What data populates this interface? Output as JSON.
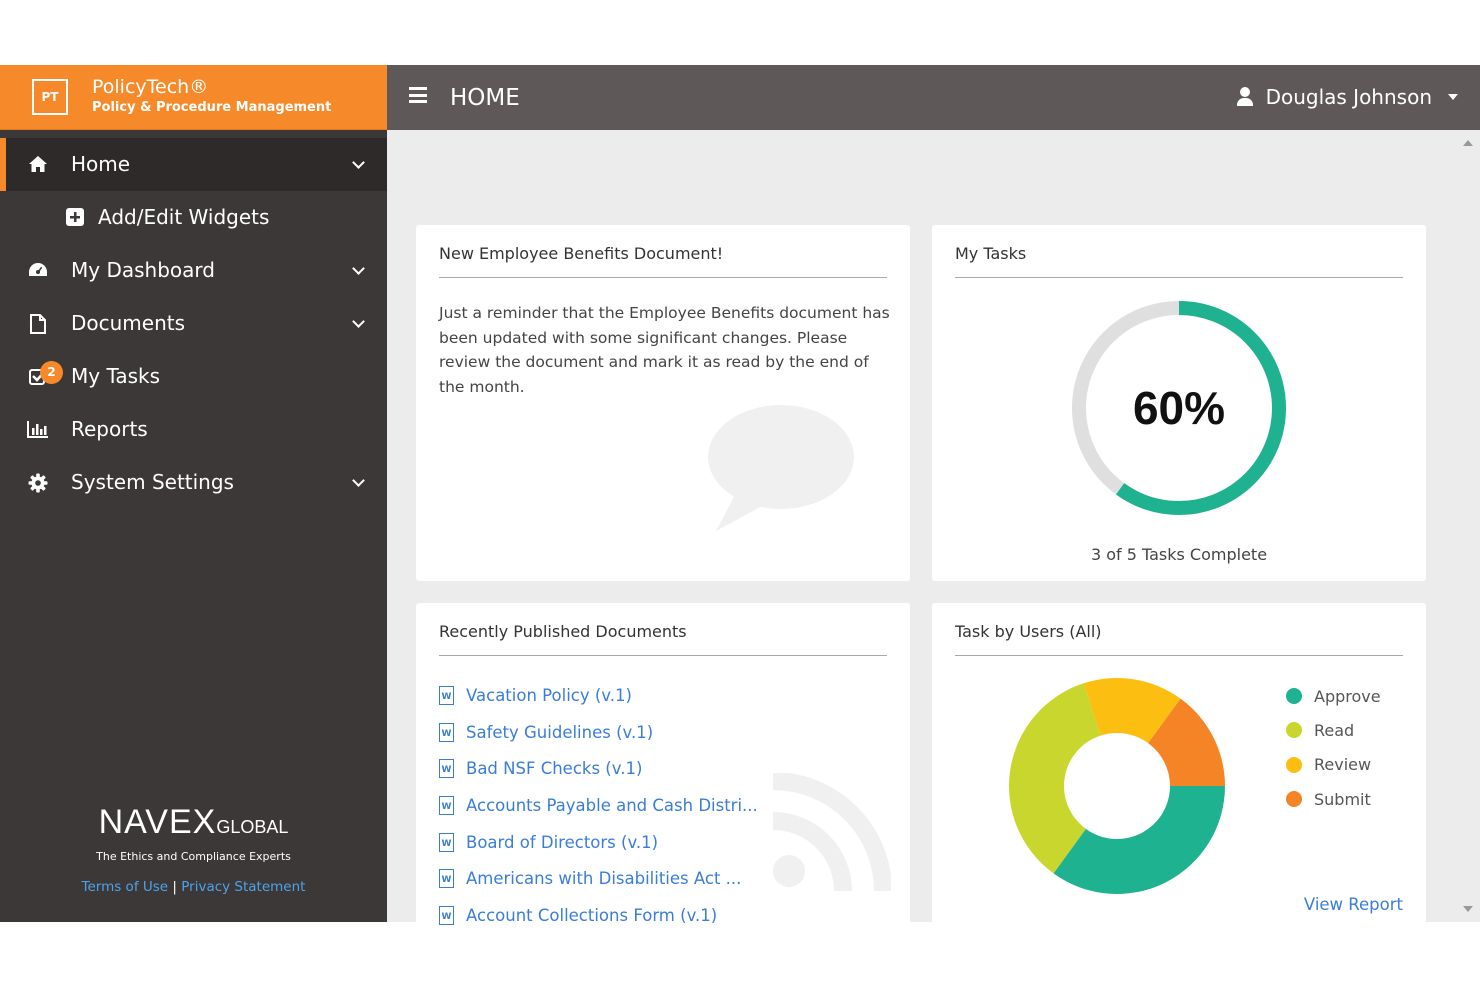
{
  "brand": {
    "logo_text": "PT",
    "title": "PolicyTech®",
    "subtitle": "Policy & Procedure Management"
  },
  "header": {
    "title": "HOME",
    "user_name": "Douglas Johnson"
  },
  "sidebar": {
    "items": [
      {
        "label": "Home",
        "icon": "home-icon"
      },
      {
        "label": "Add/Edit Widgets",
        "icon": "plus-square-icon"
      },
      {
        "label": "My Dashboard",
        "icon": "dashboard-icon"
      },
      {
        "label": "Documents",
        "icon": "document-icon"
      },
      {
        "label": "My Tasks",
        "icon": "checkbox-icon",
        "badge": "2"
      },
      {
        "label": "Reports",
        "icon": "bar-chart-icon"
      },
      {
        "label": "System Settings",
        "icon": "gear-icon"
      }
    ],
    "footer": {
      "logo_main": "NAVEX",
      "logo_sub": "GLOBAL",
      "tagline": "The Ethics and Compliance Experts",
      "terms": "Terms of Use",
      "separator": "|",
      "privacy": "Privacy Statement"
    }
  },
  "widgets": {
    "announcement": {
      "title": "New Employee Benefits Document!",
      "body": "Just a reminder that the Employee Benefits document has been updated with some significant changes. Please review the document and mark it as read by the end of the month."
    },
    "my_tasks": {
      "title": "My Tasks",
      "percent_label": "60%",
      "completed": 3,
      "total": 5,
      "caption": "3 of 5 Tasks Complete"
    },
    "recent_docs": {
      "title": "Recently Published Documents",
      "items": [
        "Vacation Policy (v.1)",
        "Safety Guidelines (v.1)",
        "Bad NSF Checks (v.1)",
        "Accounts Payable and Cash Distri...",
        "Board of Directors (v.1)",
        "Americans with Disabilities Act ...",
        "Account Collections Form (v.1)"
      ]
    },
    "task_by_users": {
      "title": "Task by Users (All)",
      "view_report": "View Report"
    }
  },
  "colors": {
    "brand_orange": "#f68a2a",
    "approve": "#1fb290",
    "read": "#c8d62e",
    "review": "#fcbf11",
    "submit": "#f58426",
    "link": "#3a7dd8"
  },
  "chart_data": {
    "type": "pie",
    "title": "Task by Users (All)",
    "categories": [
      "Approve",
      "Read",
      "Review",
      "Submit"
    ],
    "values": [
      35,
      35,
      15,
      15
    ],
    "legend_position": "right"
  }
}
